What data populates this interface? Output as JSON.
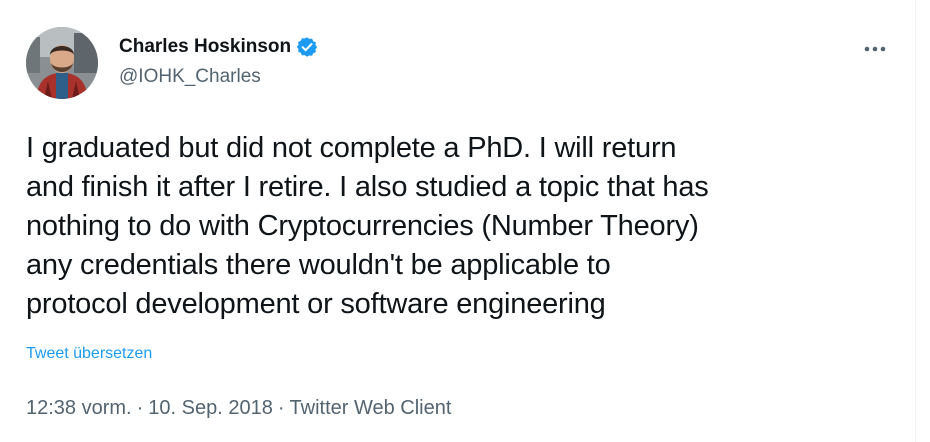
{
  "author": {
    "name": "Charles Hoskinson",
    "handle": "@IOHK_Charles",
    "verified": true,
    "verified_color": "#1d9bf0"
  },
  "tweet": {
    "text": "I graduated but did not complete a PhD. I will return\nand finish it after I retire. I also studied a topic that has\nnothing to do with Cryptocurrencies (Number Theory)\nany credentials there wouldn't be applicable to\nprotocol development or software engineering",
    "translate_label": "Tweet übersetzen",
    "time": "12:38 vorm.",
    "separator": "·",
    "date": "10. Sep. 2018",
    "client": "Twitter Web Client"
  },
  "icons": {
    "more": "more-options-icon",
    "verified": "verified-badge-icon"
  },
  "colors": {
    "text": "#0f1419",
    "secondary": "#536471",
    "accent": "#1d9bf0"
  }
}
